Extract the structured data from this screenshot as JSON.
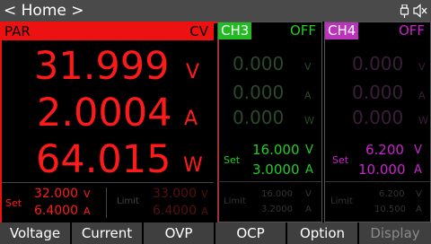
{
  "header": {
    "title": "< Home >",
    "icons": [
      "usb-icon",
      "speaker-mute-icon"
    ]
  },
  "colors": {
    "par": "#ff1a1a",
    "ch3": "#22cc22",
    "ch4": "#cc22cc",
    "dim": "#444444"
  },
  "par": {
    "tag": "PAR",
    "mode": "CV",
    "voltage": "31.999",
    "voltage_unit": "V",
    "current": "2.0004",
    "current_unit": "A",
    "power": "64.015",
    "power_unit": "W",
    "set_label": "Set",
    "set_v": "32.000",
    "set_v_unit": "V",
    "set_a": "6.4000",
    "set_a_unit": "A",
    "limit_label": "Limit",
    "limit_v": "33.000",
    "limit_v_unit": "V",
    "limit_a": "6.4000",
    "limit_a_unit": "A"
  },
  "ch3": {
    "tag": "CH3",
    "state": "OFF",
    "voltage": "0.000",
    "voltage_unit": "V",
    "current": "0.000",
    "current_unit": "A",
    "power": "0.000",
    "power_unit": "W",
    "set_label": "Set",
    "set_v": "16.000",
    "set_v_unit": "V",
    "set_a": "3.0000",
    "set_a_unit": "A",
    "limit_label": "Limit",
    "limit_v": "16.000",
    "limit_v_unit": "V",
    "limit_a": "3.2000",
    "limit_a_unit": "A"
  },
  "ch4": {
    "tag": "CH4",
    "state": "OFF",
    "voltage": "0.000",
    "voltage_unit": "V",
    "current": "0.000",
    "current_unit": "A",
    "power": "0.000",
    "power_unit": "W",
    "set_label": "Set",
    "set_v": "6.200",
    "set_v_unit": "V",
    "set_a": "10.000",
    "set_a_unit": "A",
    "limit_label": "Limit",
    "limit_v": "6.200",
    "limit_v_unit": "V",
    "limit_a": "10.500",
    "limit_a_unit": "A"
  },
  "menu": [
    "Voltage",
    "Current",
    "OVP",
    "OCP",
    "Option",
    "Display"
  ]
}
